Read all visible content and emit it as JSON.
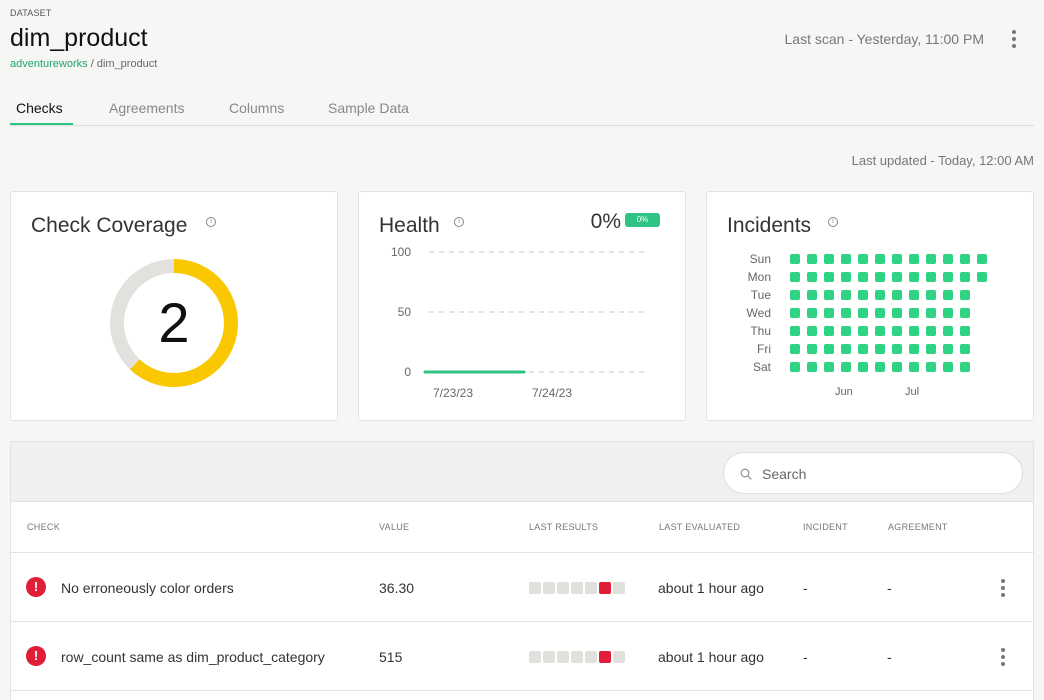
{
  "header": {
    "eyebrow": "DATASET",
    "title": "dim_product",
    "breadcrumb_link": "adventureworks",
    "breadcrumb_sep": " / ",
    "breadcrumb_current": "dim_product",
    "last_scan": "Last scan - Yesterday, 11:00 PM"
  },
  "tabs": [
    {
      "label": "Checks",
      "active": true
    },
    {
      "label": "Agreements",
      "active": false
    },
    {
      "label": "Columns",
      "active": false
    },
    {
      "label": "Sample Data",
      "active": false
    }
  ],
  "last_updated": "Last updated - Today, 12:00 AM",
  "coverage": {
    "title": "Check Coverage",
    "value": "2",
    "covered_fraction": 0.62,
    "colors": {
      "covered": "#f9c800",
      "uncovered": "#e2e1de"
    }
  },
  "health": {
    "title": "Health",
    "percent": "0%",
    "badge": "0%",
    "accent": "#2ec283"
  },
  "chart_data": {
    "type": "line",
    "title": "Health",
    "x": [
      "7/23/23",
      "7/24/23"
    ],
    "series": [
      {
        "values": [
          0,
          0
        ]
      }
    ],
    "yticks": [
      "100",
      "50",
      "0"
    ],
    "ylim": [
      0,
      100
    ],
    "grid": true
  },
  "incidents": {
    "title": "Incidents",
    "days": [
      "Sun",
      "Mon",
      "Tue",
      "Wed",
      "Thu",
      "Fri",
      "Sat"
    ],
    "weeks_per_day": [
      12,
      12,
      11,
      11,
      11,
      11,
      11
    ],
    "months": [
      "Jun",
      "Jul"
    ],
    "dot_color": "#2ed483"
  },
  "search": {
    "placeholder": "Search"
  },
  "table": {
    "columns": [
      "CHECK",
      "VALUE",
      "LAST RESULTS",
      "LAST EVALUATED",
      "INCIDENT",
      "AGREEMENT"
    ],
    "rows": [
      {
        "check": "No erroneously color orders",
        "value": "36.30",
        "results": [
          "ok",
          "ok",
          "ok",
          "ok",
          "ok",
          "fail",
          "ok"
        ],
        "evaluated": "about 1 hour ago",
        "incident": "-",
        "agreement": "-"
      },
      {
        "check": "row_count same as dim_product_category",
        "value": "515",
        "results": [
          "ok",
          "ok",
          "ok",
          "ok",
          "ok",
          "fail",
          "ok"
        ],
        "evaluated": "about 1 hour ago",
        "incident": "-",
        "agreement": "-"
      }
    ]
  }
}
